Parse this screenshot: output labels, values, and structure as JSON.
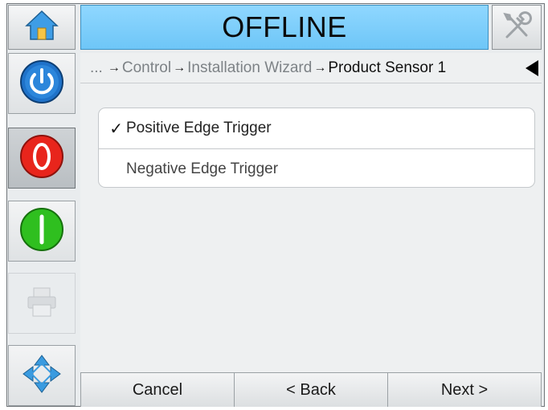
{
  "header": {
    "status": "OFFLINE",
    "home_icon": "home-icon",
    "tools_icon": "tools-icon"
  },
  "sidebar": {
    "buttons": [
      {
        "name": "power-icon",
        "color": "#1f72c9"
      },
      {
        "name": "stop-icon",
        "color": "#e8251c"
      },
      {
        "name": "start-icon",
        "color": "#2fbf1f"
      },
      {
        "name": "printer-icon",
        "color": "#c8cbce"
      },
      {
        "name": "navigate-icon",
        "color": "#3a9be0"
      }
    ]
  },
  "breadcrumb": {
    "ellipsis": "...",
    "items": [
      "Control",
      "Installation Wizard",
      "Product Sensor 1"
    ],
    "separator": "→"
  },
  "options": [
    {
      "label": "Positive Edge Trigger",
      "selected": true,
      "check": "✓"
    },
    {
      "label": "Negative Edge Trigger",
      "selected": false,
      "check": ""
    }
  ],
  "footer": {
    "cancel": "Cancel",
    "back": "< Back",
    "next": "Next >"
  }
}
